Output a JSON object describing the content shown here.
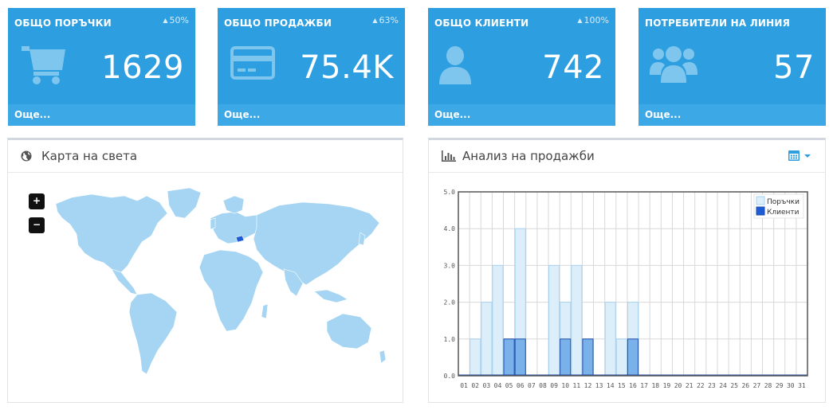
{
  "stats": [
    {
      "title": "ОБЩО ПОРЪЧКИ",
      "pct": "50%",
      "value": "1629",
      "more": "Още...",
      "icon": "shopping-cart-icon"
    },
    {
      "title": "ОБЩО ПРОДАЖБИ",
      "pct": "63%",
      "value": "75.4K",
      "more": "Още...",
      "icon": "credit-card-icon"
    },
    {
      "title": "ОБЩО КЛИЕНТИ",
      "pct": "100%",
      "value": "742",
      "more": "Още...",
      "icon": "user-icon"
    },
    {
      "title": "ПОТРЕБИТЕЛИ НА ЛИНИЯ",
      "pct": "",
      "value": "57",
      "more": "Още...",
      "icon": "users-icon"
    }
  ],
  "map_panel": {
    "title": "Карта на света",
    "zoom_in": "+",
    "zoom_out": "−",
    "highlight_color": "#1e5bd6",
    "land_color": "#a5d5f2"
  },
  "sales_panel": {
    "title": "Анализ на продажби"
  },
  "colors": {
    "accent": "#2d9ee0",
    "orders": "#dbeefa",
    "clients": "#7ab1ea"
  },
  "chart_data": {
    "type": "bar",
    "categories": [
      "01",
      "02",
      "03",
      "04",
      "05",
      "06",
      "07",
      "08",
      "09",
      "10",
      "11",
      "12",
      "13",
      "14",
      "15",
      "16",
      "17",
      "18",
      "19",
      "20",
      "21",
      "22",
      "23",
      "24",
      "25",
      "26",
      "27",
      "28",
      "29",
      "30",
      "31"
    ],
    "series": [
      {
        "name": "Поръчки",
        "values": [
          0,
          1,
          2,
          3,
          1,
          4,
          0,
          0,
          3,
          2,
          3,
          1,
          0,
          2,
          1,
          2,
          0,
          0,
          0,
          0,
          0,
          0,
          0,
          0,
          0,
          0,
          0,
          0,
          0,
          0,
          0
        ]
      },
      {
        "name": "Клиенти",
        "values": [
          0,
          0,
          0,
          0,
          1,
          1,
          0,
          0,
          0,
          1,
          0,
          1,
          0,
          0,
          0,
          1,
          0,
          0,
          0,
          0,
          0,
          0,
          0,
          0,
          0,
          0,
          0,
          0,
          0,
          0,
          0
        ]
      }
    ],
    "ylim": [
      0,
      5
    ],
    "yticks": [
      "0.0",
      "1.0",
      "2.0",
      "3.0",
      "4.0",
      "5.0"
    ],
    "legend": "top-right",
    "grid": true
  }
}
